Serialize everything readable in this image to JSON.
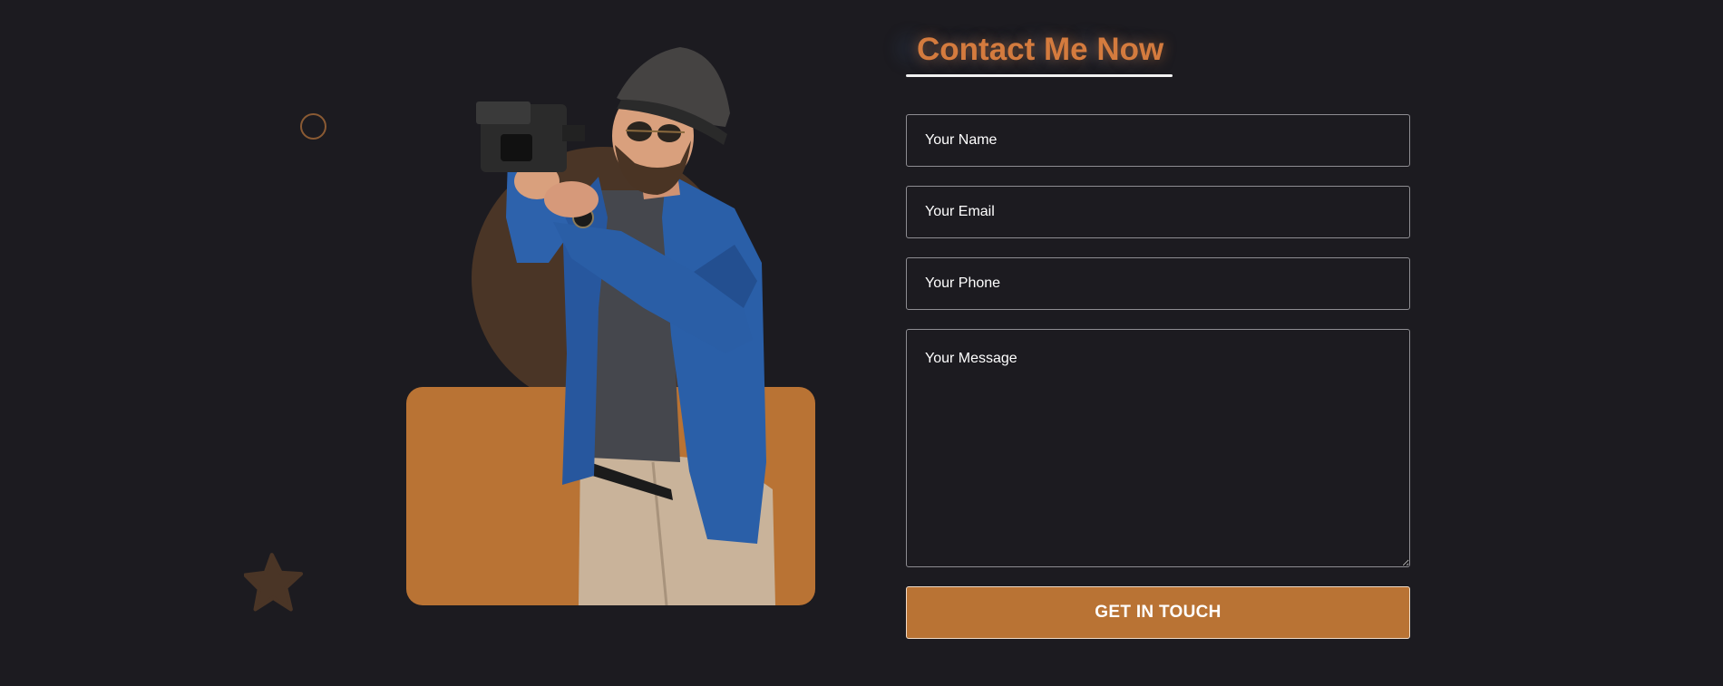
{
  "contact": {
    "heading": "Contact Me Now",
    "name_placeholder": "Your Name",
    "email_placeholder": "Your Email",
    "phone_placeholder": "Your Phone",
    "message_placeholder": "Your Message",
    "submit_label": "GET IN TOUCH"
  },
  "colors": {
    "background": "#1c1b20",
    "accent": "#b97334",
    "heading": "#d47b3e",
    "decor": "#4a3526"
  },
  "icons": {
    "decor_ring": "ring-icon",
    "decor_star_left": "star-icon",
    "decor_star_right": "star-icon",
    "photo": "photographer-illustration"
  }
}
